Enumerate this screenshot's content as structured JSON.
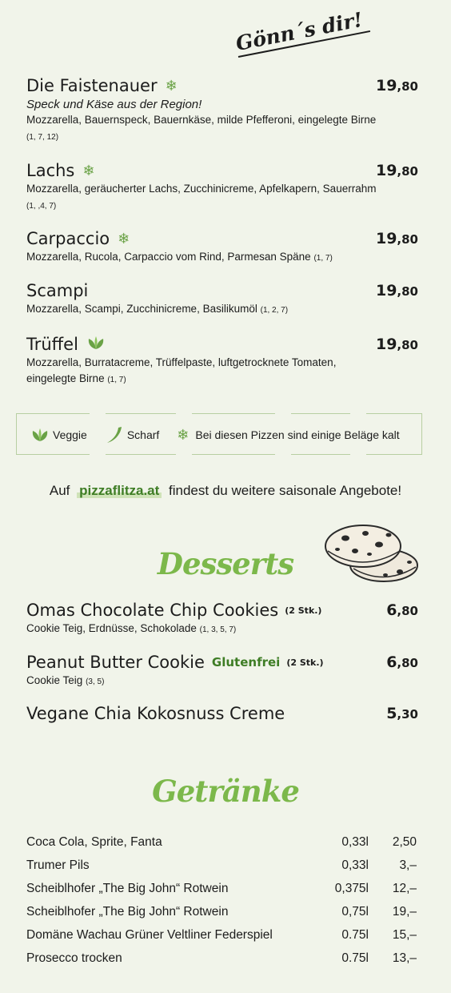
{
  "tagline": "Gönn´s dir!",
  "pizzas": [
    {
      "name": "Die Faistenauer",
      "icon": "snowflake-icon",
      "price_main": "19",
      "price_cents": ",80",
      "subtitle": "Speck und Käse aus der Region!",
      "desc": "Mozzarella, Bauernspeck, Bauernkäse, milde Pfefferoni, eingelegte Birne",
      "allergens": "(1, 7, 12)"
    },
    {
      "name": "Lachs",
      "icon": "snowflake-icon",
      "price_main": "19",
      "price_cents": ",80",
      "desc": "Mozzarella, geräucherter Lachs, Zucchinicreme, Apfelkapern, Sauerrahm",
      "allergens": "(1, ,4, 7)"
    },
    {
      "name": "Carpaccio",
      "icon": "snowflake-icon",
      "price_main": "19",
      "price_cents": ",80",
      "desc": "Mozzarella, Rucola, Carpaccio vom Rind, Parmesan Späne",
      "allergens": "(1, 7)"
    },
    {
      "name": "Scampi",
      "price_main": "19",
      "price_cents": ",80",
      "desc": "Mozzarella, Scampi, Zucchinicreme, Basilikumöl",
      "allergens": "(1, 2, 7)"
    },
    {
      "name": "Trüffel",
      "icon": "veggie-leaf-icon",
      "price_main": "19",
      "price_cents": ",80",
      "desc": "Mozzarella, Burratacreme, Trüffelpaste, luftgetrocknete Tomaten, eingelegte Birne",
      "allergens": "(1, 7)"
    }
  ],
  "legend": {
    "veggie": "Veggie",
    "spicy": "Scharf",
    "cold": "Bei diesen Pizzen sind einige Beläge kalt"
  },
  "promo": {
    "before": "Auf",
    "link": "pizzaflitza.at",
    "after": "findest du weitere saisonale Angebote!"
  },
  "desserts_title": "Desserts",
  "desserts": [
    {
      "name": "Omas Chocolate Chip Cookies",
      "qty": "(2 Stk.)",
      "price_main": "6",
      "price_cents": ",80",
      "desc": "Cookie Teig, Erdnüsse, Schokolade",
      "allergens": "(1, 3, 5, 7)"
    },
    {
      "name": "Peanut Butter Cookie",
      "extra": "Glutenfrei",
      "qty": "(2 Stk.)",
      "price_main": "6",
      "price_cents": ",80",
      "desc": "Cookie Teig",
      "allergens": "(3, 5)"
    },
    {
      "name": "Vegane Chia Kokosnuss Creme",
      "price_main": "5",
      "price_cents": ",30"
    }
  ],
  "drinks_title": "Getränke",
  "drinks": [
    {
      "name": "Coca Cola, Sprite, Fanta",
      "volume": "0,33l",
      "price": "2,50"
    },
    {
      "name": "Trumer Pils",
      "volume": "0,33l",
      "price": "3,–"
    },
    {
      "name": "Scheiblhofer „The Big John“ Rotwein",
      "volume": "0,375l",
      "price": "12,–"
    },
    {
      "name": "Scheiblhofer „The Big John“ Rotwein",
      "volume": "0,75l",
      "price": "19,–"
    },
    {
      "name": "Domäne Wachau Grüner Veltliner Federspiel",
      "volume": "0.75l",
      "price": "15,–"
    },
    {
      "name": "Prosecco trocken",
      "volume": "0.75l",
      "price": "13,–"
    }
  ],
  "colors": {
    "accent": "#7cb84b",
    "dark_green": "#3e7d25",
    "background": "#f1f4ea"
  }
}
